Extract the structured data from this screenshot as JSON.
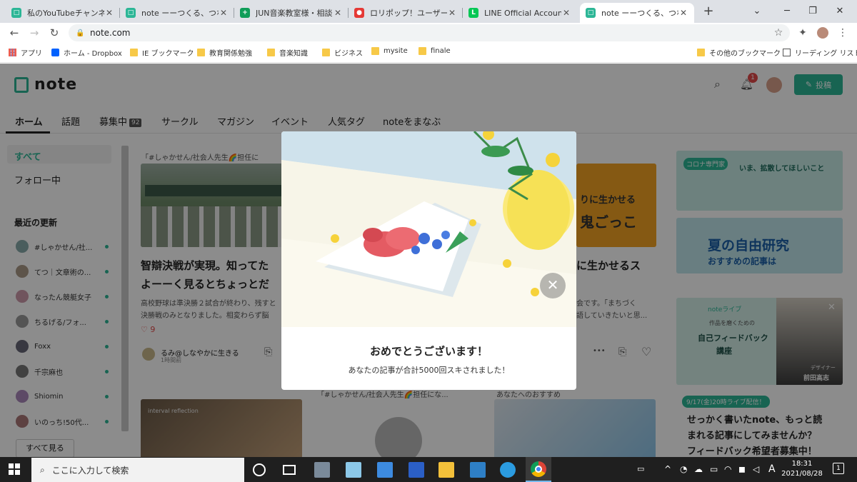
{
  "browser": {
    "tabs": [
      {
        "title": "私のYouTubeチャンネル",
        "favicon_color": "#2cb696",
        "active": false
      },
      {
        "title": "note ーーつくる、つなが",
        "favicon_color": "#2cb696",
        "active": false
      },
      {
        "title": "JUN音楽教室様・相談",
        "favicon_color": "#0f9d58",
        "active": false
      },
      {
        "title": "ロリポップ！ユーザー専用",
        "favicon_color": "#e53935",
        "active": false
      },
      {
        "title": "LINE Official Account",
        "favicon_color": "#06c755",
        "active": false
      },
      {
        "title": "note ーーつくる、つなが",
        "favicon_color": "#2cb696",
        "active": true
      }
    ],
    "new_tab_glyph": "+",
    "url": "note.com",
    "bookmarks": [
      {
        "label": "アプリ",
        "icon": "apps-grid-icon"
      },
      {
        "label": "ホーム - Dropbox",
        "icon": "dropbox-icon"
      },
      {
        "label": "IE ブックマーク",
        "icon": "folder-icon"
      },
      {
        "label": "教育関係勉強",
        "icon": "folder-icon"
      },
      {
        "label": "音楽知識",
        "icon": "folder-icon"
      },
      {
        "label": "ビジネス",
        "icon": "folder-icon"
      },
      {
        "label": "mysite",
        "icon": "folder-icon"
      },
      {
        "label": "finale",
        "icon": "folder-icon"
      }
    ],
    "other_bookmarks": "その他のブックマーク",
    "reading_list": "リーディング リスト"
  },
  "site": {
    "logo": "note",
    "notification_count": "1",
    "post_button": "投稿",
    "nav": [
      {
        "label": "ホーム",
        "active": true
      },
      {
        "label": "話題"
      },
      {
        "label": "募集中",
        "badge": "92"
      },
      {
        "label": "サークル"
      },
      {
        "label": "マガジン"
      },
      {
        "label": "イベント"
      },
      {
        "label": "人気タグ"
      },
      {
        "label": "noteをまなぶ"
      }
    ],
    "sidebar": {
      "all": "すべて",
      "following": "フォロー中",
      "recent_heading": "最近の更新",
      "users": [
        {
          "name": "#しゃかせん/社...",
          "color": "#8aa"
        },
        {
          "name": "てつ｜文章術の...",
          "color": "#a98"
        },
        {
          "name": "なったん競艇女子",
          "color": "#c9a"
        },
        {
          "name": "ちるげる/フォ...",
          "color": "#999"
        },
        {
          "name": "Foxx",
          "color": "#667"
        },
        {
          "name": "千宗麻也",
          "color": "#777"
        },
        {
          "name": "Shiomin",
          "color": "#a8b"
        },
        {
          "name": "いのっち!50代...",
          "color": "#a77"
        }
      ],
      "see_all": "すべて見る"
    },
    "feed": {
      "magazine_label": "「#しゃかせん/社会人先生🌈担任に",
      "article_title_1": "智辯決戦が実現。知ってた",
      "article_title_2": "よーーく見るとちょっとだ",
      "article_excerpt_1": "高校野球は準決勝２試合が終わり、残すと",
      "article_excerpt_2": "決勝戦のみとなりました。相変わらず脳",
      "likes": "9",
      "author": "るみ@しなやかに生きる",
      "posted": "1時間前",
      "magazine_label_2": "「#しゃかせん/社会人先生🌈担任にな...",
      "recommend_label": "あなたへのおすすめ",
      "image_caption": "interval reflection",
      "right_title_1": "に生かせるス",
      "right_excerpt_1": "会です。「まちづく",
      "right_excerpt_2": "語していきたいと思...",
      "right_banner_text": "りに生かせる",
      "right_banner_text_2": "鬼ごっこ",
      "more_glyph": "•••"
    },
    "ads": {
      "ad1_tag": "コロナ専門家",
      "ad1_head": "いま、拡散してほしいこと",
      "ad2_head": "夏の自由研究",
      "ad2_sub": "おすすめの記事は",
      "ad3_brand": "noteライブ",
      "ad3_line1": "作品を磨くための",
      "ad3_line2": "自己フィードバック",
      "ad3_line3": "講座",
      "ad3_person_role": "デザイナー",
      "ad3_person": "前田高志",
      "ad3_date": "9/17(金)20時ライブ配信！",
      "ad3_title_1": "せっかく書いたnote、もっと読",
      "ad3_title_2": "まれる記事にしてみませんか？",
      "ad3_title_3": "フィードバック希望者募集中！"
    }
  },
  "modal": {
    "title": "おめでとうございます！",
    "message": "あなたの記事が合計5000回スキされました！",
    "close_glyph": "✕"
  },
  "taskbar": {
    "search_placeholder": "ここに入力して検索",
    "ime": "A",
    "time": "18:31",
    "date": "2021/08/28",
    "notifications": "1"
  },
  "colors": {
    "brand": "#2cb696",
    "badge": "#e24a4a"
  }
}
